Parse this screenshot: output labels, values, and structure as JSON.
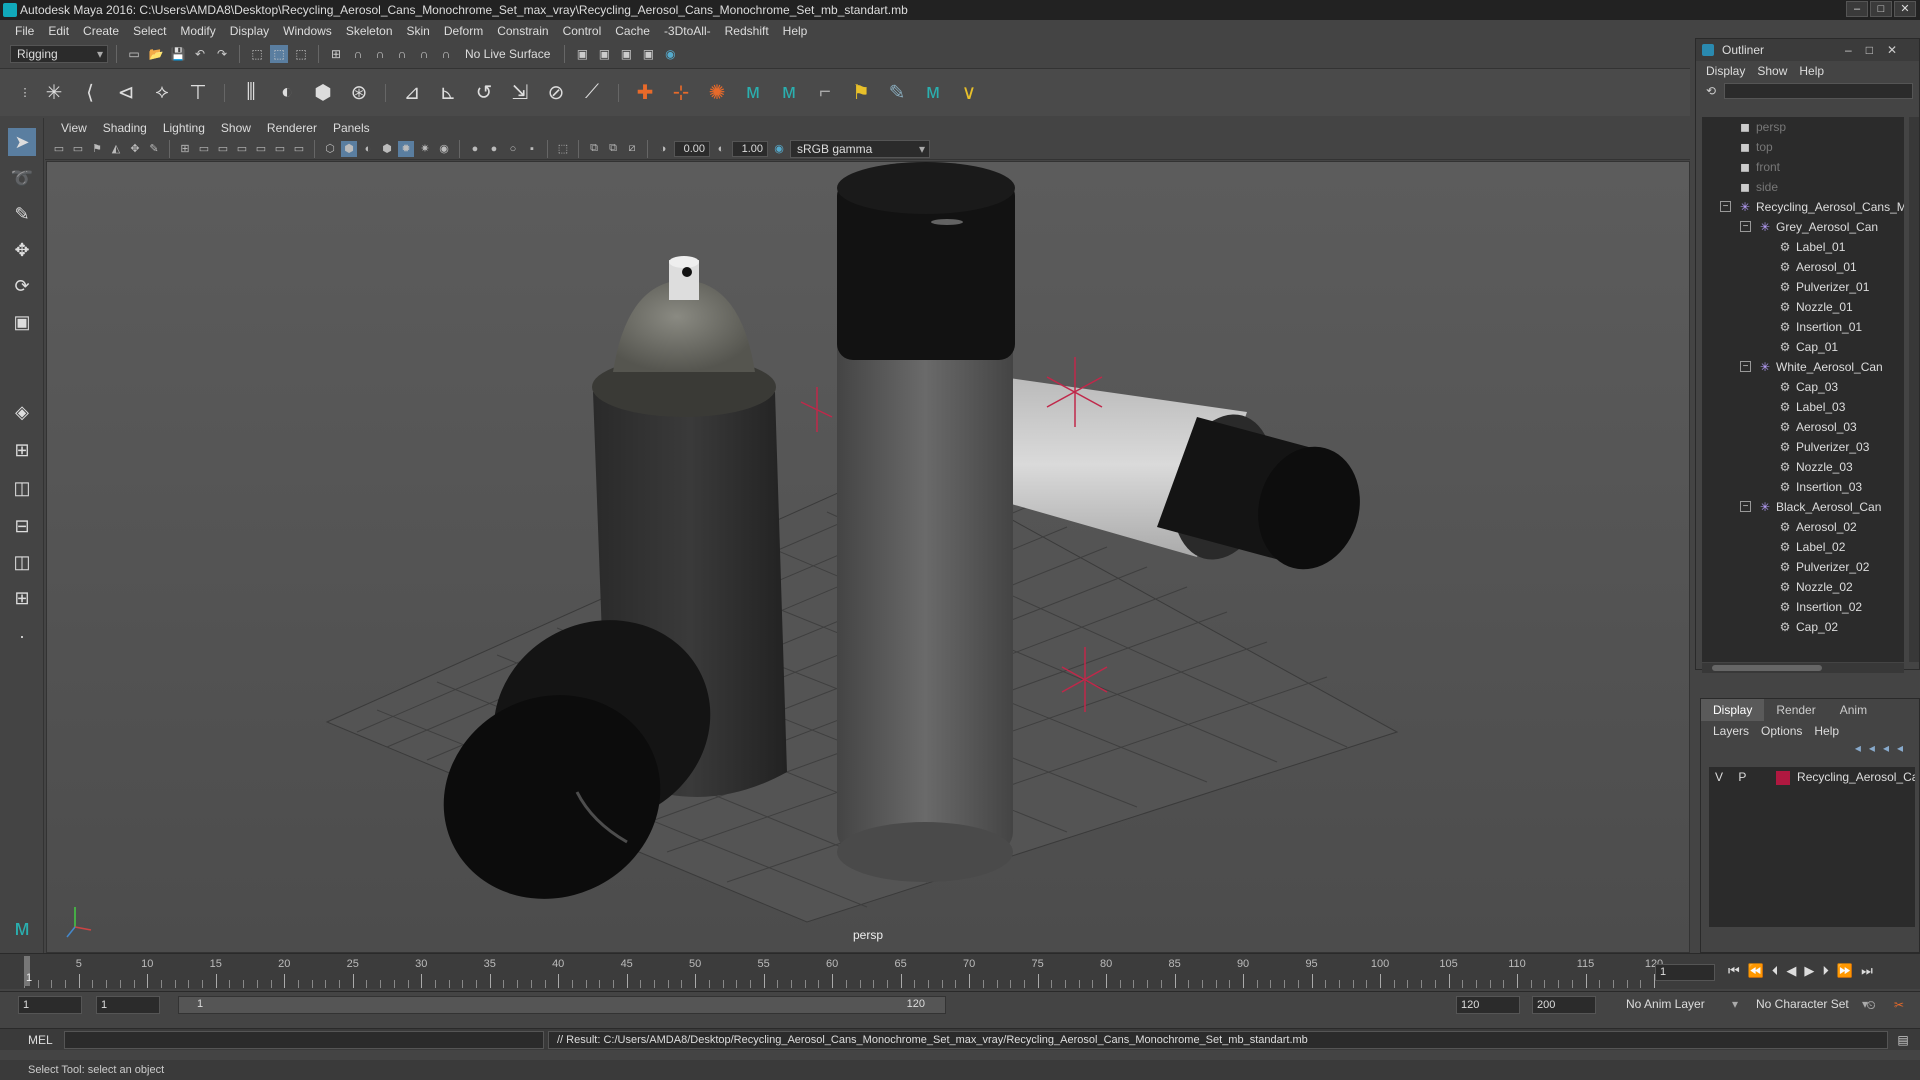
{
  "window": {
    "title": "Autodesk Maya 2016: C:\\Users\\AMDA8\\Desktop\\Recycling_Aerosol_Cans_Monochrome_Set_max_vray\\Recycling_Aerosol_Cans_Monochrome_Set_mb_standart.mb",
    "minimize": "–",
    "maximize": "□",
    "close": "✕"
  },
  "menubar": [
    "File",
    "Edit",
    "Create",
    "Select",
    "Modify",
    "Display",
    "Windows",
    "Skeleton",
    "Skin",
    "Deform",
    "Constrain",
    "Control",
    "Cache",
    "-3DtoAll-",
    "Redshift",
    "Help"
  ],
  "shelf": {
    "mode": "Rigging",
    "live_surface": "No Live Surface"
  },
  "viewport_menu": [
    "View",
    "Shading",
    "Lighting",
    "Show",
    "Renderer",
    "Panels"
  ],
  "viewport_toolbar": {
    "exposure": "0.00",
    "gamma": "1.00",
    "color_space": "sRGB gamma"
  },
  "viewport": {
    "camera_label": "persp"
  },
  "outliner": {
    "title": "Outliner",
    "menu": [
      "Display",
      "Show",
      "Help"
    ],
    "items": [
      {
        "label": "persp",
        "depth": 0,
        "kind": "camera",
        "dim": true
      },
      {
        "label": "top",
        "depth": 0,
        "kind": "camera",
        "dim": true
      },
      {
        "label": "front",
        "depth": 0,
        "kind": "camera",
        "dim": true
      },
      {
        "label": "side",
        "depth": 0,
        "kind": "camera",
        "dim": true
      },
      {
        "label": "Recycling_Aerosol_Cans_M",
        "depth": 0,
        "kind": "group",
        "expand": "−"
      },
      {
        "label": "Grey_Aerosol_Can",
        "depth": 1,
        "kind": "group",
        "expand": "−"
      },
      {
        "label": "Label_01",
        "depth": 2,
        "kind": "mesh"
      },
      {
        "label": "Aerosol_01",
        "depth": 2,
        "kind": "mesh"
      },
      {
        "label": "Pulverizer_01",
        "depth": 2,
        "kind": "mesh"
      },
      {
        "label": "Nozzle_01",
        "depth": 2,
        "kind": "mesh"
      },
      {
        "label": "Insertion_01",
        "depth": 2,
        "kind": "mesh"
      },
      {
        "label": "Cap_01",
        "depth": 2,
        "kind": "mesh"
      },
      {
        "label": "White_Aerosol_Can",
        "depth": 1,
        "kind": "group",
        "expand": "−"
      },
      {
        "label": "Cap_03",
        "depth": 2,
        "kind": "mesh"
      },
      {
        "label": "Label_03",
        "depth": 2,
        "kind": "mesh"
      },
      {
        "label": "Aerosol_03",
        "depth": 2,
        "kind": "mesh"
      },
      {
        "label": "Pulverizer_03",
        "depth": 2,
        "kind": "mesh"
      },
      {
        "label": "Nozzle_03",
        "depth": 2,
        "kind": "mesh"
      },
      {
        "label": "Insertion_03",
        "depth": 2,
        "kind": "mesh"
      },
      {
        "label": "Black_Aerosol_Can",
        "depth": 1,
        "kind": "group",
        "expand": "−"
      },
      {
        "label": "Aerosol_02",
        "depth": 2,
        "kind": "mesh"
      },
      {
        "label": "Label_02",
        "depth": 2,
        "kind": "mesh"
      },
      {
        "label": "Pulverizer_02",
        "depth": 2,
        "kind": "mesh"
      },
      {
        "label": "Nozzle_02",
        "depth": 2,
        "kind": "mesh"
      },
      {
        "label": "Insertion_02",
        "depth": 2,
        "kind": "mesh"
      },
      {
        "label": "Cap_02",
        "depth": 2,
        "kind": "mesh"
      }
    ]
  },
  "layers": {
    "tabs": [
      "Display",
      "Render",
      "Anim"
    ],
    "active_tab": "Display",
    "menu": [
      "Layers",
      "Options",
      "Help"
    ],
    "rows": [
      {
        "v": "V",
        "p": "P",
        "color": "#b01840",
        "name": "Recycling_Aerosol_Car"
      }
    ]
  },
  "timeline": {
    "ticks": [
      "5",
      "10",
      "15",
      "20",
      "25",
      "30",
      "35",
      "40",
      "45",
      "50",
      "55",
      "60",
      "65",
      "70",
      "75",
      "80",
      "85",
      "90",
      "95",
      "100",
      "105",
      "110",
      "115",
      "120"
    ],
    "start": 1,
    "end": 120,
    "playhead_label": "1",
    "current_frame": "1"
  },
  "range": {
    "start_a": "1",
    "start_b": "1",
    "slider_start": "1",
    "slider_end": "120",
    "end_a": "120",
    "end_b": "200",
    "anim_layer": "No Anim Layer",
    "character_set": "No Character Set"
  },
  "command": {
    "lang": "MEL",
    "result": "// Result: C:/Users/AMDA8/Desktop/Recycling_Aerosol_Cans_Monochrome_Set_max_vray/Recycling_Aerosol_Cans_Monochrome_Set_mb_standart.mb"
  },
  "helpline": "Select Tool: select an object",
  "colors": {
    "accent": "#5a9bd0",
    "layer": "#b01840",
    "group_icon": "#b9a0ff"
  }
}
